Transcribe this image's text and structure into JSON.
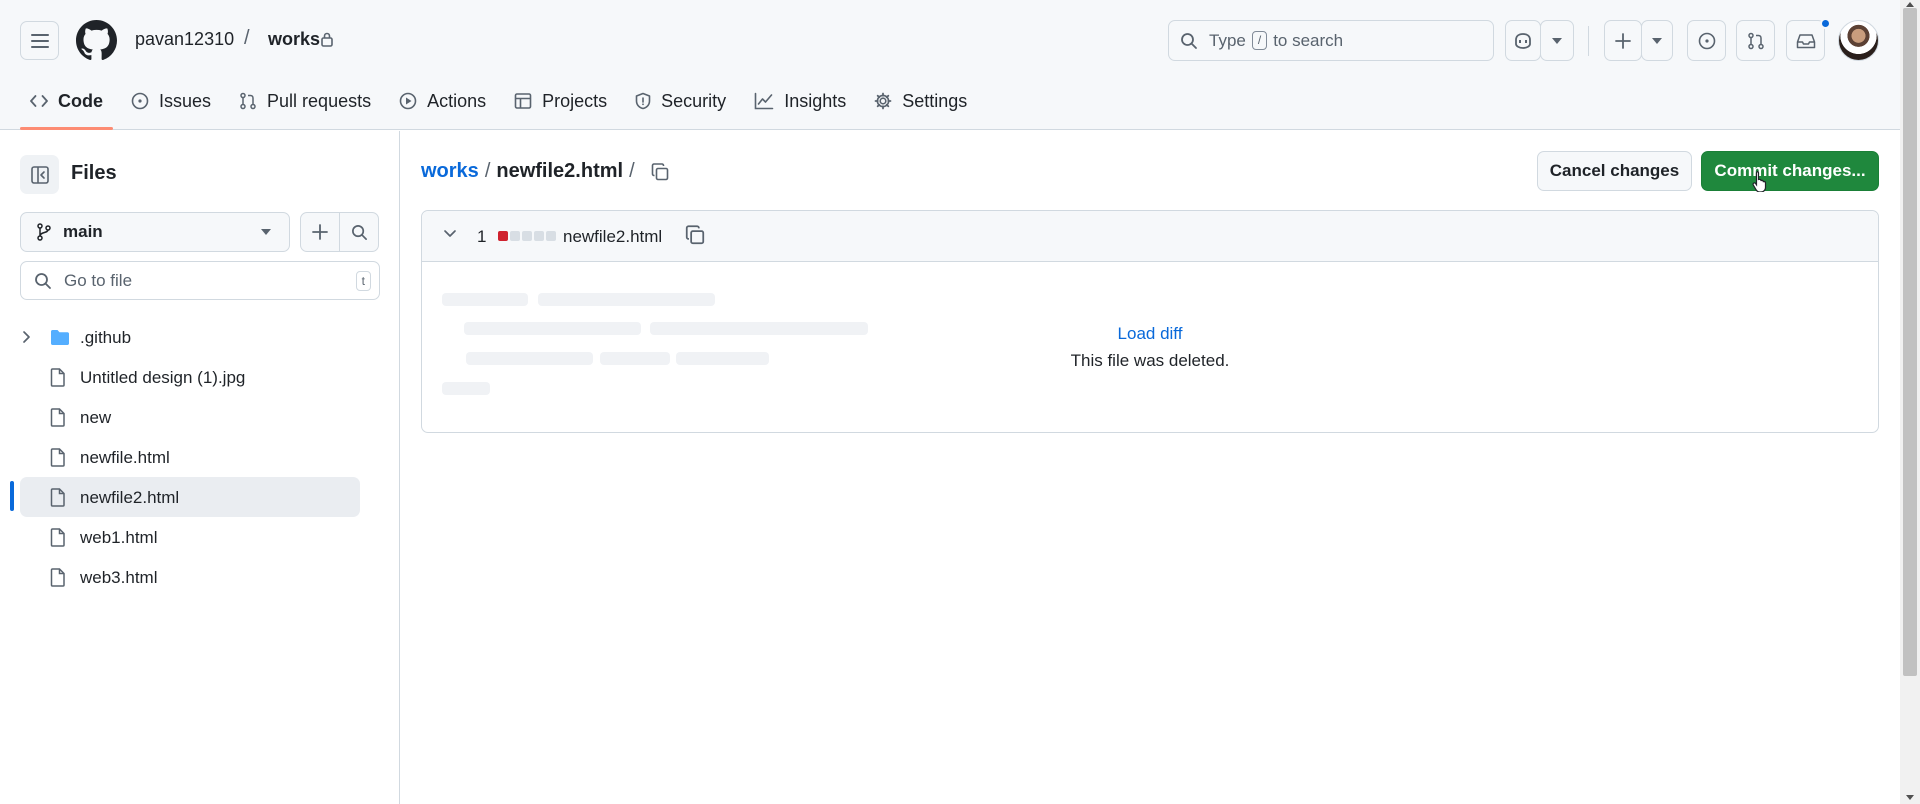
{
  "header": {
    "owner": "pavan12310",
    "separator": "/",
    "repo": "works",
    "search_placeholder_prefix": "Type",
    "search_key": "/",
    "search_placeholder_suffix": "to search"
  },
  "tabs": [
    {
      "label": "Code",
      "icon": "code-icon",
      "active": true
    },
    {
      "label": "Issues",
      "icon": "issue-opened-icon"
    },
    {
      "label": "Pull requests",
      "icon": "git-pull-request-icon"
    },
    {
      "label": "Actions",
      "icon": "play-icon"
    },
    {
      "label": "Projects",
      "icon": "table-icon"
    },
    {
      "label": "Security",
      "icon": "shield-icon"
    },
    {
      "label": "Insights",
      "icon": "graph-icon"
    },
    {
      "label": "Settings",
      "icon": "gear-icon"
    }
  ],
  "sidebar": {
    "title": "Files",
    "branch": "main",
    "goto_placeholder": "Go to file",
    "goto_key": "t",
    "items": [
      {
        "label": ".github",
        "type": "folder"
      },
      {
        "label": "Untitled design (1).jpg",
        "type": "file"
      },
      {
        "label": "new",
        "type": "file"
      },
      {
        "label": "newfile.html",
        "type": "file"
      },
      {
        "label": "newfile2.html",
        "type": "file",
        "selected": true
      },
      {
        "label": "web1.html",
        "type": "file"
      },
      {
        "label": "web3.html",
        "type": "file"
      }
    ]
  },
  "breadcrumb": {
    "repo": "works",
    "sep": "/",
    "file": "newfile2.html",
    "trailing_sep": "/"
  },
  "actions": {
    "cancel": "Cancel changes",
    "commit": "Commit changes..."
  },
  "diff": {
    "count": "1",
    "filename": "newfile2.html",
    "load_diff": "Load diff",
    "message": "This file was deleted."
  },
  "colors": {
    "accent": "#0969da",
    "commit_green": "#1f883d",
    "tab_underline": "#fd8c73",
    "deletion": "#cf222e"
  }
}
